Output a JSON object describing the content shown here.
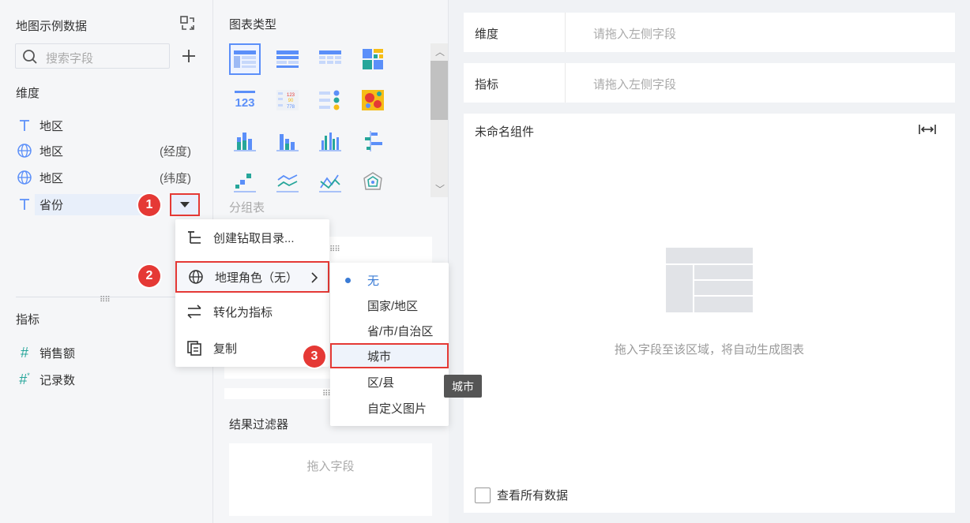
{
  "left": {
    "title": "地图示例数据",
    "search_placeholder": "搜索字段",
    "dimension_label": "维度",
    "dimensions": [
      {
        "name": "地区",
        "suffix": ""
      },
      {
        "name": "地区",
        "suffix": "(经度)"
      },
      {
        "name": "地区",
        "suffix": "(纬度)"
      },
      {
        "name": "省份",
        "suffix": ""
      }
    ],
    "measure_label": "指标",
    "measures": [
      {
        "name": "销售额"
      },
      {
        "name": "记录数"
      }
    ]
  },
  "middle": {
    "chart_type_title": "图表类型",
    "group_label": "分组表",
    "filter_title": "结果过滤器",
    "filter_placeholder": "拖入字段"
  },
  "right": {
    "dimension_label": "维度",
    "dimension_placeholder": "请拖入左侧字段",
    "measure_label": "指标",
    "measure_placeholder": "请拖入左侧字段",
    "widget_title": "未命名组件",
    "widget_hint": "拖入字段至该区域，将自动生成图表",
    "view_all_label": "查看所有数据"
  },
  "context_menu": {
    "items": [
      {
        "label": "创建钻取目录..."
      },
      {
        "label": "地理角色（无）"
      },
      {
        "label": "转化为指标"
      },
      {
        "label": "复制"
      }
    ]
  },
  "geo_submenu": {
    "items": [
      {
        "label": "无",
        "selected": true
      },
      {
        "label": "国家/地区"
      },
      {
        "label": "省/市/自治区"
      },
      {
        "label": "城市"
      },
      {
        "label": "区/县"
      },
      {
        "label": "自定义图片"
      }
    ]
  },
  "tooltip": "城市",
  "markers": [
    "1",
    "2",
    "3"
  ],
  "colors": {
    "accent": "#3a7bd5",
    "marker": "#e53935",
    "selected_chart": "#5b8ff9"
  }
}
